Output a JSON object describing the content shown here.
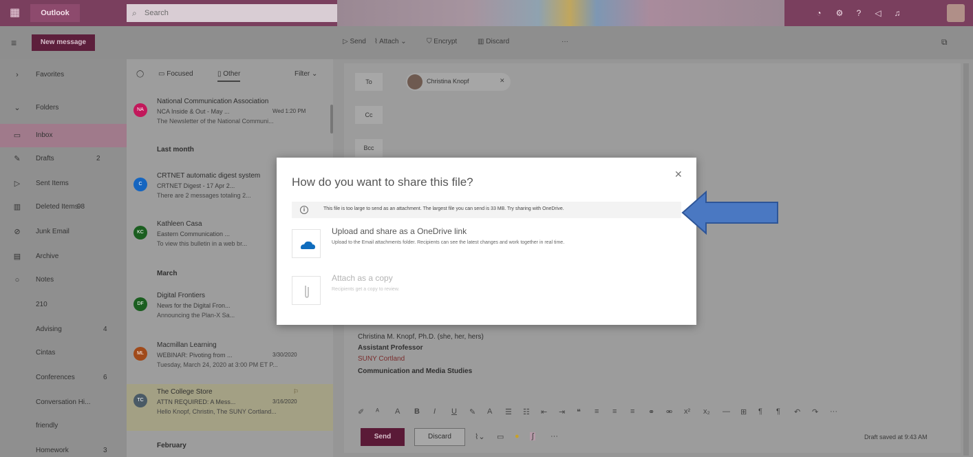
{
  "app": {
    "name": "Outlook",
    "search_placeholder": "Search"
  },
  "compose_toolbar": {
    "new_message": "New message",
    "send": "Send",
    "attach": "Attach",
    "encrypt": "Encrypt",
    "discard": "Discard"
  },
  "nav": {
    "items": [
      {
        "label": "Favorites",
        "icon": "chevron-right-icon",
        "count": ""
      },
      {
        "label": "Folders",
        "icon": "chevron-down-icon",
        "count": ""
      },
      {
        "label": "Inbox",
        "icon": "inbox-icon",
        "count": ""
      },
      {
        "label": "Drafts",
        "icon": "pencil-icon",
        "count": "2"
      },
      {
        "label": "Sent Items",
        "icon": "send-icon",
        "count": ""
      },
      {
        "label": "Deleted Items",
        "icon": "trash-icon",
        "count": "98"
      },
      {
        "label": "Junk Email",
        "icon": "block-icon",
        "count": ""
      },
      {
        "label": "Archive",
        "icon": "archive-icon",
        "count": ""
      },
      {
        "label": "Notes",
        "icon": "note-icon",
        "count": ""
      },
      {
        "label": "210",
        "icon": "",
        "count": ""
      },
      {
        "label": "Advising",
        "icon": "",
        "count": "4"
      },
      {
        "label": "Cintas",
        "icon": "",
        "count": ""
      },
      {
        "label": "Conferences",
        "icon": "",
        "count": "6"
      },
      {
        "label": "Conversation Hi...",
        "icon": "",
        "count": ""
      },
      {
        "label": "friendly",
        "icon": "",
        "count": ""
      },
      {
        "label": "Homework",
        "icon": "",
        "count": "3"
      }
    ]
  },
  "message_list": {
    "tabs": {
      "focused": "Focused",
      "other": "Other",
      "filter": "Filter"
    },
    "groups": {
      "last_month": "Last month",
      "march": "March",
      "february": "February"
    },
    "messages": [
      {
        "initials": "NA",
        "color": "#c2185b",
        "sender": "National Communication Association",
        "subject": "NCA Inside & Out - May ...",
        "date": "Wed 1:20 PM",
        "preview": "The Newsletter of the National Communi..."
      },
      {
        "initials": "C",
        "color": "#1565c0",
        "sender": "CRTNET automatic digest system",
        "subject": "CRTNET Digest - 17 Apr 2...",
        "date": "",
        "preview": "There are 2 messages totaling 2..."
      },
      {
        "initials": "KC",
        "color": "#1b5e20",
        "sender": "Kathleen Casa",
        "subject": "Eastern Communication ...",
        "date": "",
        "preview": "To view this bulletin in a web br..."
      },
      {
        "initials": "DF",
        "color": "#1b5e20",
        "sender": "Digital Frontiers",
        "subject": "News for the Digital Fron...",
        "date": "",
        "preview": "Announcing the Plan-X Sa..."
      },
      {
        "initials": "ML",
        "color": "#a04a1a",
        "sender": "Macmillan Learning",
        "subject": "WEBINAR: Pivoting from ...",
        "date": "3/30/2020",
        "preview": "Tuesday, March 24, 2020 at 3:00 PM ET P..."
      },
      {
        "initials": "TC",
        "color": "#4a5a66",
        "sender": "The College Store",
        "subject": "ATTN REQUIRED: A Mess...",
        "date": "3/16/2020",
        "preview": "Hello Knopf, Christin, The SUNY Cortland..."
      }
    ]
  },
  "compose": {
    "to_label": "To",
    "cc_label": "Cc",
    "bcc_label": "Bcc",
    "recipient": "Christina Knopf",
    "signature": {
      "name": "Christina M. Knopf, Ph.D. (she, her, hers)",
      "title": "Assistant Professor",
      "org": "SUNY Cortland",
      "dept": "Communication and Media Studies"
    },
    "send": "Send",
    "discard": "Discard",
    "draft_status": "Draft saved at 9:43 AM"
  },
  "dialog": {
    "title": "How do you want to share this file?",
    "info": "This file is too large to send as an attachment. The largest file you can send is 33 MB. Try sharing with OneDrive.",
    "options": [
      {
        "title": "Upload and share as a OneDrive link",
        "desc": "Upload to the Email attachments folder. Recipients can see the latest changes and work together in real time.",
        "enabled": true
      },
      {
        "title": "Attach as a copy",
        "desc": "Recipients get a copy to review.",
        "enabled": false
      }
    ]
  },
  "colors": {
    "brand": "#7a3f5e",
    "accent_arrow": "#4a78c2",
    "onedrive_blue": "#0f6cbd"
  }
}
